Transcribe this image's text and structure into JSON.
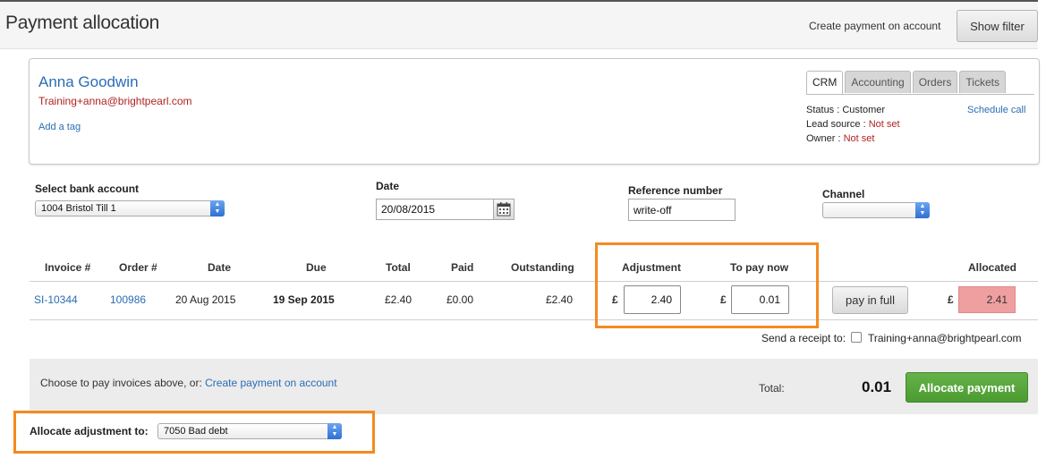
{
  "header": {
    "title": "Payment allocation",
    "create_link": "Create payment on account",
    "show_filter": "Show filter"
  },
  "contact": {
    "name": "Anna Goodwin",
    "email": "Training+anna@brightpearl.com",
    "add_tag": "Add a tag",
    "tabs": [
      "CRM",
      "Accounting",
      "Orders",
      "Tickets"
    ],
    "active_tab": "CRM",
    "status_label": "Status :",
    "status_value": "Customer",
    "lead_label": "Lead source :",
    "lead_value": "Not set",
    "owner_label": "Owner :",
    "owner_value": "Not set",
    "schedule_call": "Schedule call"
  },
  "form": {
    "bank_label": "Select bank account",
    "bank_value": "1004 Bristol Till 1",
    "date_label": "Date",
    "date_value": "20/08/2015",
    "ref_label": "Reference number",
    "ref_value": "write-off",
    "channel_label": "Channel",
    "channel_value": ""
  },
  "table": {
    "headers": {
      "invoice": "Invoice #",
      "order": "Order #",
      "date": "Date",
      "due": "Due",
      "total": "Total",
      "paid": "Paid",
      "outstanding": "Outstanding",
      "adjustment": "Adjustment",
      "to_pay_now": "To pay now",
      "allocated": "Allocated"
    },
    "row": {
      "invoice": "SI-10344",
      "order": "100986",
      "date": "20 Aug 2015",
      "due": "19 Sep 2015",
      "total": "£2.40",
      "paid": "£0.00",
      "outstanding": "£2.40",
      "currency": "£",
      "adjustment": "2.40",
      "to_pay_now": "0.01",
      "pay_in_full": "pay in full",
      "allocated": "2.41"
    }
  },
  "receipt": {
    "label": "Send a receipt to:",
    "checked": false,
    "email": "Training+anna@brightpearl.com"
  },
  "footer": {
    "text": "Choose to pay invoices above, or:",
    "create_link": "Create payment on account",
    "total_label": "Total:",
    "total_value": "0.01",
    "allocate_button": "Allocate payment"
  },
  "adjustment_allocation": {
    "label": "Allocate adjustment to:",
    "value": "7050 Bad debt"
  },
  "colors": {
    "highlight": "#f58a1f",
    "link": "#2a6db5",
    "error_red": "#b22222",
    "allocated_bg": "#ef9f9f",
    "primary_button": "#4f9e34"
  }
}
